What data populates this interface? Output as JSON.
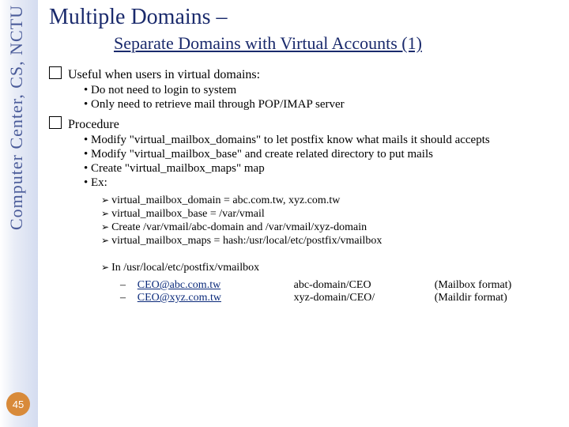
{
  "sidebar": {
    "label": "Computer Center, CS, NCTU",
    "page": "45"
  },
  "title": "Multiple Domains –",
  "subtitle": "Separate Domains with Virtual Accounts (1)",
  "sec1": {
    "head": "Useful when users in virtual domains:",
    "items": [
      "Do not need to login to system",
      "Only need to retrieve mail through POP/IMAP server"
    ]
  },
  "sec2": {
    "head": "Procedure",
    "items": [
      "Modify \"virtual_mailbox_domains\" to let postfix know what mails it should accepts",
      "Modify \"virtual_mailbox_base\" and create related directory to put mails",
      "Create \"virtual_mailbox_maps\" map",
      "Ex:"
    ],
    "ex": [
      "virtual_mailbox_domain = abc.com.tw, xyz.com.tw",
      "virtual_mailbox_base = /var/vmail",
      "Create /var/vmail/abc-domain and /var/vmail/xyz-domain",
      "virtual_mailbox_maps = hash:/usr/local/etc/postfix/vmailbox"
    ],
    "in_line": "In /usr/local/etc/postfix/vmailbox",
    "table": [
      {
        "email": "CEO@abc.com.tw",
        "dir": "abc-domain/CEO",
        "fmt": "(Mailbox format)"
      },
      {
        "email": "CEO@xyz.com.tw",
        "dir": "xyz-domain/CEO/",
        "fmt": "(Maildir format)"
      }
    ]
  }
}
